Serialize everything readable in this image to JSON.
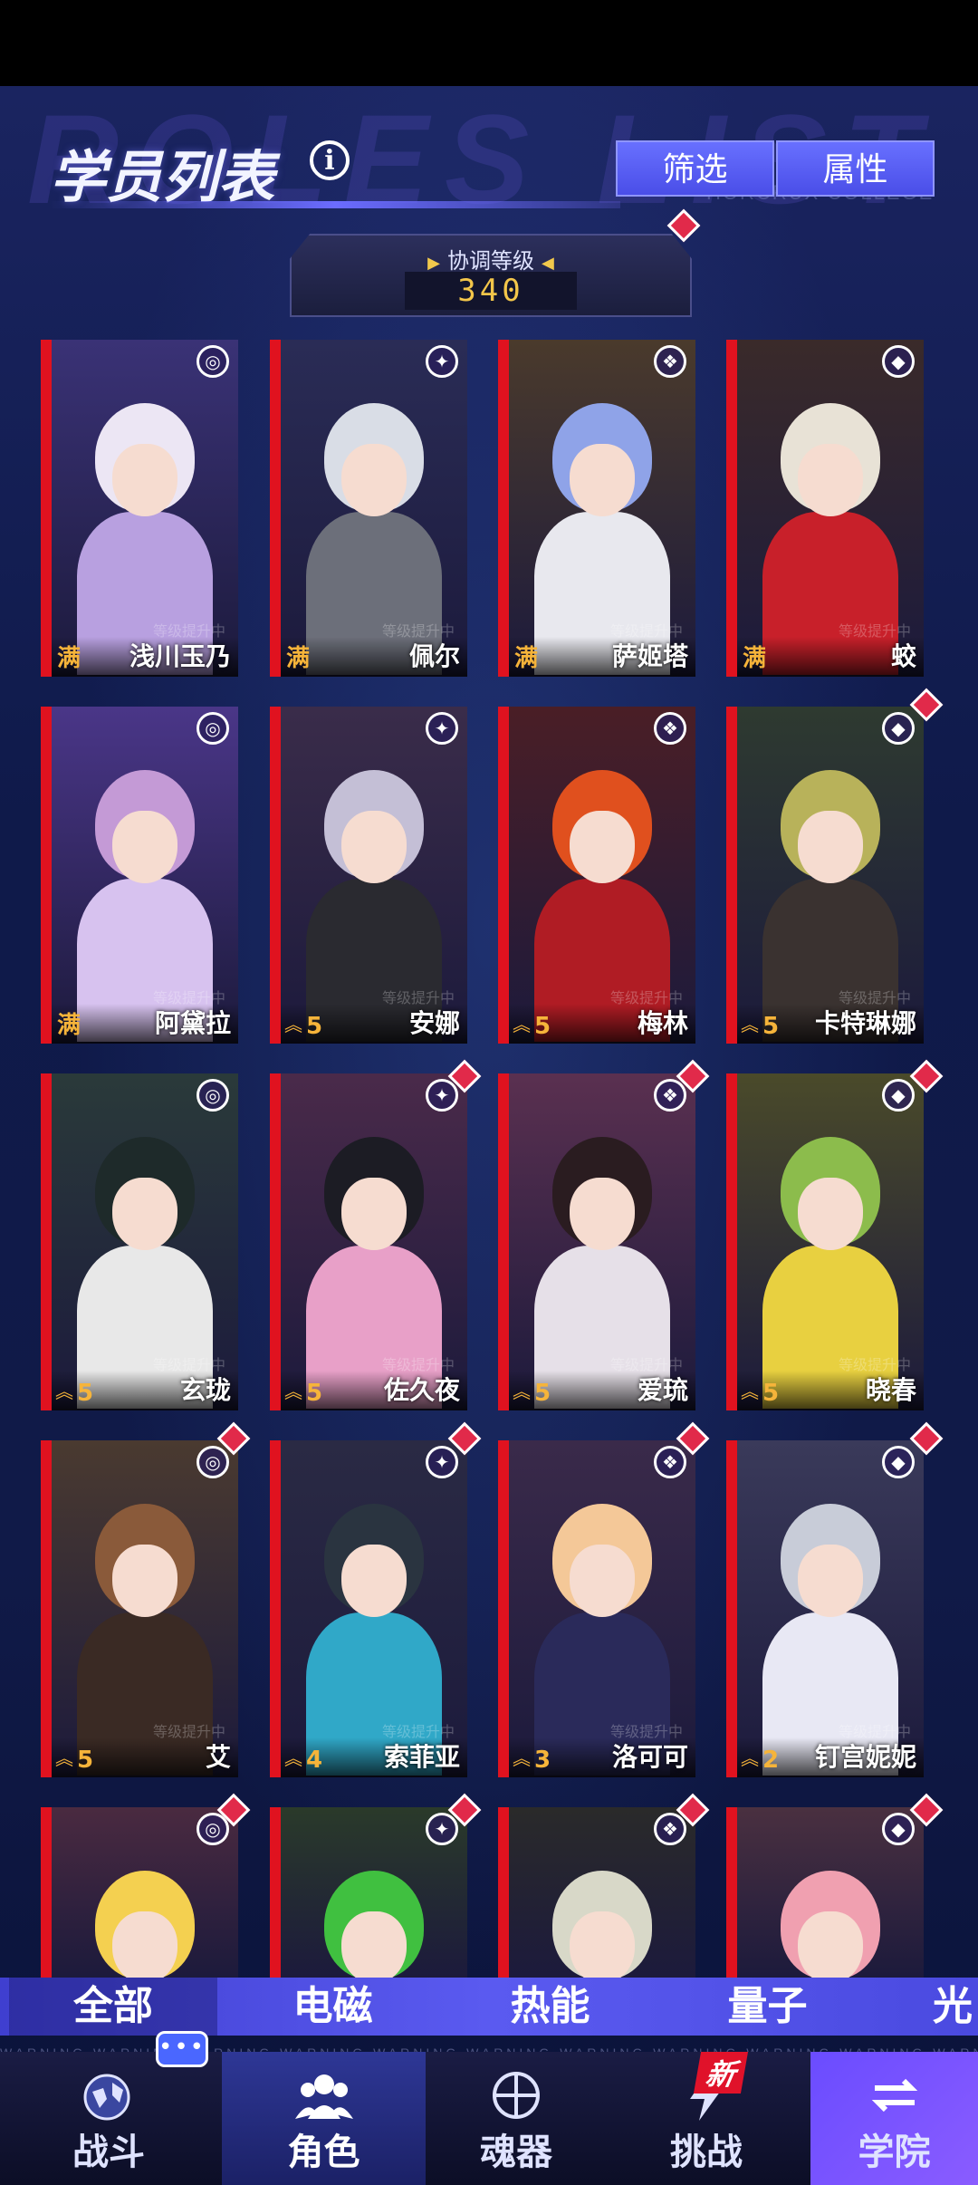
{
  "header": {
    "title": "学员列表",
    "watermark": "ROLES LIST",
    "subwatermark": "HORCRUX COLLEGE",
    "buttons": {
      "filter": "筛选",
      "attribute": "属性"
    }
  },
  "level": {
    "label": "协调等级",
    "value": "340"
  },
  "cards": [
    {
      "name": "浅川玉乃",
      "rank": "满",
      "hair": "#ece6f4",
      "outfit": "#b8a0e0",
      "bg": "#3a3276"
    },
    {
      "name": "佩尔",
      "rank": "满",
      "hair": "#d9dde6",
      "outfit": "#6c6f7a",
      "bg": "#2a2c56"
    },
    {
      "name": "萨姬塔",
      "rank": "满",
      "hair": "#8fa3e8",
      "outfit": "#e8e8ee",
      "bg": "#4a3a2c"
    },
    {
      "name": "蛟",
      "rank": "满",
      "hair": "#e8e2d6",
      "outfit": "#c8202a",
      "bg": "#3a2a2a"
    },
    {
      "name": "阿黛拉",
      "rank": "满",
      "hair": "#c49ad6",
      "outfit": "#d7c2ef",
      "bg": "#4a3688"
    },
    {
      "name": "安娜",
      "rank": "5",
      "hair": "#c4bfd6",
      "outfit": "#2a2a30",
      "bg": "#3a2c4a"
    },
    {
      "name": "梅林",
      "rank": "5",
      "hair": "#e0501e",
      "outfit": "#b01c24",
      "bg": "#4a1e26"
    },
    {
      "name": "卡特琳娜",
      "rank": "5",
      "hair": "#b8b25a",
      "outfit": "#3a3230",
      "bg": "#2e3a30"
    },
    {
      "name": "玄珑",
      "rank": "5",
      "hair": "#1e2a2a",
      "outfit": "#e8e8e8",
      "bg": "#2a3a3a"
    },
    {
      "name": "佐久夜",
      "rank": "5",
      "hair": "#1c1c24",
      "outfit": "#e8a0c8",
      "bg": "#4a2a4a"
    },
    {
      "name": "爱琉",
      "rank": "5",
      "hair": "#2a1c20",
      "outfit": "#e6e0e8",
      "bg": "#5a3050"
    },
    {
      "name": "晓春",
      "rank": "5",
      "hair": "#8cbc4c",
      "outfit": "#e8d040",
      "bg": "#4a4a2a"
    },
    {
      "name": "艾",
      "rank": "5",
      "hair": "#8a5a3a",
      "outfit": "#3a2a24",
      "bg": "#4a3a30"
    },
    {
      "name": "索菲亚",
      "rank": "4",
      "hair": "#2a3440",
      "outfit": "#30a8c8",
      "bg": "#2a2a44"
    },
    {
      "name": "洛可可",
      "rank": "3",
      "hair": "#f4c898",
      "outfit": "#2a2a5a",
      "bg": "#3a2a4a"
    },
    {
      "name": "钉宫妮妮",
      "rank": "2",
      "hair": "#c8ccd8",
      "outfit": "#e8e8f4",
      "bg": "#3a3a5a"
    },
    {
      "name": "",
      "rank": "",
      "hair": "#f4d050",
      "outfit": "#f0c0c8",
      "bg": "#4a2a40"
    },
    {
      "name": "",
      "rank": "",
      "hair": "#40c040",
      "outfit": "#f0f0f0",
      "bg": "#2a3a2a"
    },
    {
      "name": "",
      "rank": "",
      "hair": "#d8d8c8",
      "outfit": "#4a4a30",
      "bg": "#2a2a2a"
    },
    {
      "name": "",
      "rank": "",
      "hair": "#f0a0b0",
      "outfit": "#f8e0e8",
      "bg": "#4a3040"
    }
  ],
  "card_hint": "等级提升中",
  "filter_tabs": [
    "全部",
    "电磁",
    "热能",
    "量子",
    "光"
  ],
  "warning_text": "WARNING  WARNING  WARNING  WARNING  WARNING  WARNING  WARNING  WARNING  WARNING  WARNING  WARNING",
  "nav": {
    "items": [
      {
        "label": "战斗",
        "icon": "globe-icon"
      },
      {
        "label": "角色",
        "icon": "characters-icon"
      },
      {
        "label": "魂器",
        "icon": "artifact-icon"
      },
      {
        "label": "挑战",
        "icon": "lightning-icon"
      },
      {
        "label": "学院",
        "icon": "academy-icon"
      }
    ],
    "chat": "•••",
    "new_badge": "新"
  },
  "colors": {
    "accent": "#5a5af0",
    "rank": "#f6b43a",
    "card_edge": "#e0121f",
    "badge": "#e12a4a"
  }
}
